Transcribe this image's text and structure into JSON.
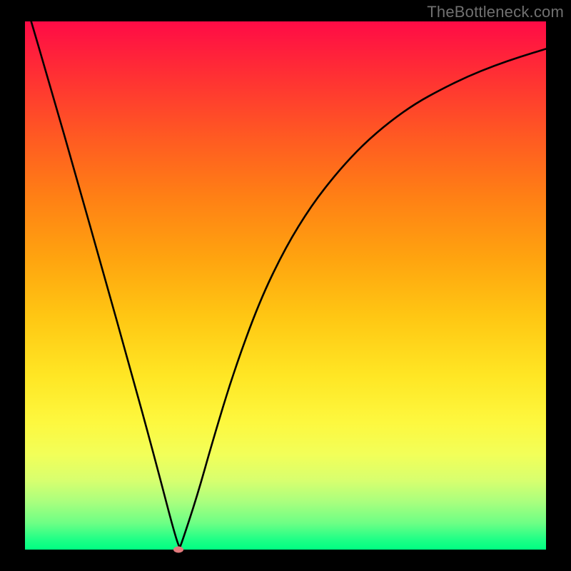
{
  "watermark": "TheBottleneck.com",
  "chart_data": {
    "type": "line",
    "title": "",
    "xlabel": "",
    "ylabel": "",
    "xlim": [
      0,
      1
    ],
    "ylim": [
      0,
      1
    ],
    "series": [
      {
        "name": "curve",
        "x": [
          0.0,
          0.05,
          0.1,
          0.15,
          0.2,
          0.25,
          0.295,
          0.3,
          0.33,
          0.36,
          0.4,
          0.45,
          0.5,
          0.55,
          0.6,
          0.65,
          0.7,
          0.75,
          0.8,
          0.85,
          0.9,
          0.95,
          1.0
        ],
        "values": [
          1.04,
          0.872,
          0.7,
          0.525,
          0.35,
          0.17,
          0.0,
          0.01,
          0.1,
          0.205,
          0.335,
          0.47,
          0.572,
          0.652,
          0.715,
          0.768,
          0.81,
          0.845,
          0.872,
          0.896,
          0.916,
          0.933,
          0.948
        ]
      }
    ],
    "marker": {
      "x": 0.295,
      "y": 0.0
    },
    "background_gradient": {
      "stops": [
        {
          "pos": 0.0,
          "color": "#ff0b46"
        },
        {
          "pos": 0.5,
          "color": "#ffc713"
        },
        {
          "pos": 0.8,
          "color": "#f2ff59"
        },
        {
          "pos": 1.0,
          "color": "#00ff82"
        }
      ]
    }
  }
}
